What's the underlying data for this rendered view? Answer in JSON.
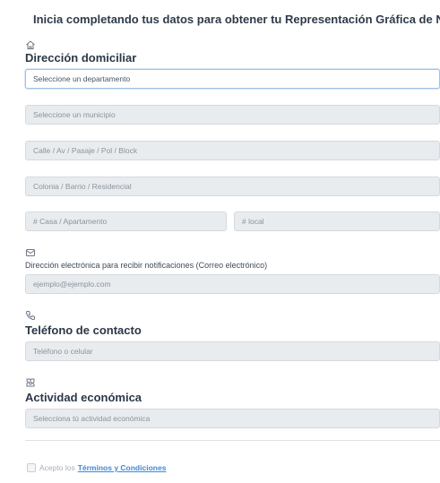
{
  "header": {
    "title": "Inicia completando tus datos para obtener tu Representación Gráfica de NIT."
  },
  "address": {
    "icon": "home-icon",
    "title": "Dirección domiciliar",
    "department_placeholder": "Seleccione un departamento",
    "municipality_placeholder": "Seleccione un municipio",
    "street_placeholder": "Calle / Av / Pasaje / Pol / Block",
    "neighborhood_placeholder": "Colonia / Barrio / Residencial",
    "house_placeholder": "# Casa / Apartamento",
    "local_placeholder": "# local"
  },
  "email": {
    "icon": "email-icon",
    "label": "Dirección electrónica para recibir notificaciones (Correo electrónico)",
    "placeholder": "ejemplo@ejemplo.com"
  },
  "phone": {
    "icon": "phone-icon",
    "title": "Teléfono de contacto",
    "placeholder": "Teléfono o celular"
  },
  "economic": {
    "icon": "economic-activity-icon",
    "title": "Actividad económica",
    "placeholder": "Selecciona tú actividad económica"
  },
  "terms": {
    "prefix": "Acepto los",
    "link": "Términos y Condiciones"
  }
}
